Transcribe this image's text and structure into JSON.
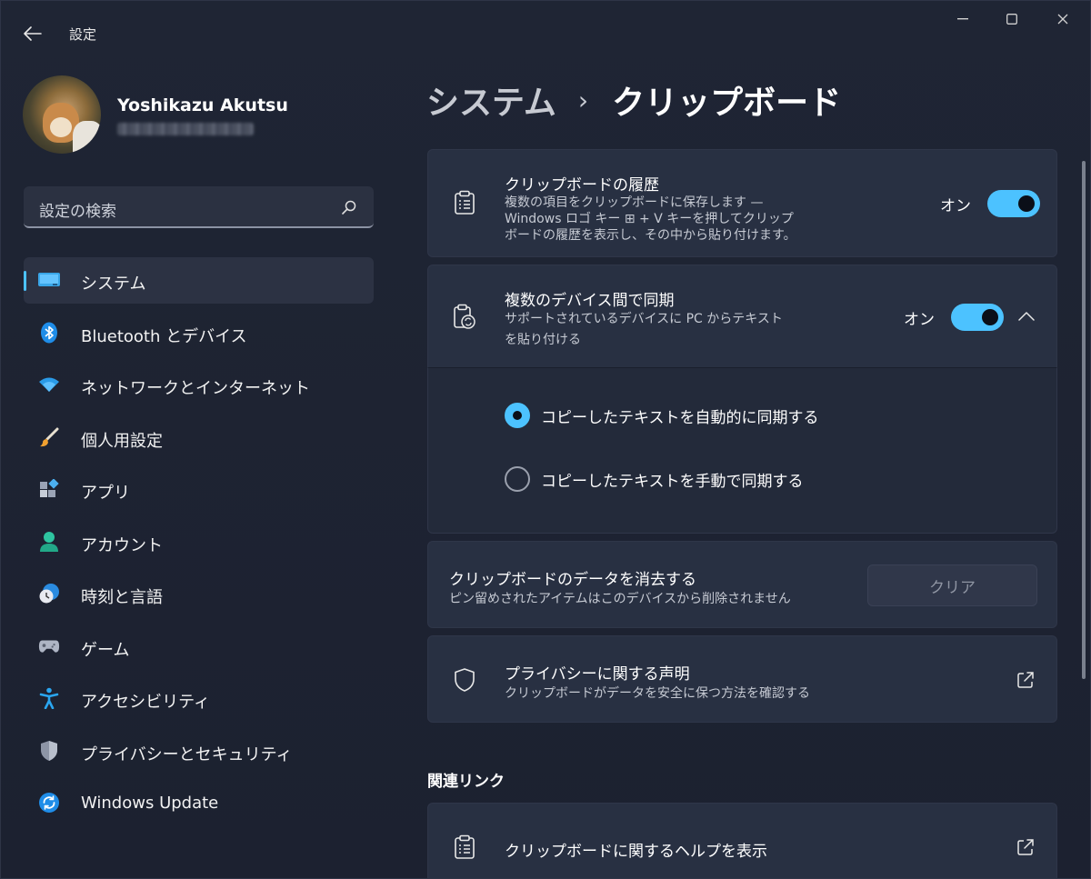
{
  "window": {
    "title": "設定"
  },
  "profile": {
    "name": "Yoshikazu Akutsu"
  },
  "search": {
    "placeholder": "設定の検索"
  },
  "sidebar": {
    "items": [
      {
        "label": "システム",
        "icon": "system-icon",
        "active": true
      },
      {
        "label": "Bluetooth とデバイス",
        "icon": "bluetooth-icon"
      },
      {
        "label": "ネットワークとインターネット",
        "icon": "wifi-icon"
      },
      {
        "label": "個人用設定",
        "icon": "brush-icon"
      },
      {
        "label": "アプリ",
        "icon": "apps-icon"
      },
      {
        "label": "アカウント",
        "icon": "account-icon"
      },
      {
        "label": "時刻と言語",
        "icon": "time-language-icon"
      },
      {
        "label": "ゲーム",
        "icon": "gamepad-icon"
      },
      {
        "label": "アクセシビリティ",
        "icon": "accessibility-icon"
      },
      {
        "label": "プライバシーとセキュリティ",
        "icon": "shield-icon"
      },
      {
        "label": "Windows Update",
        "icon": "update-icon"
      }
    ]
  },
  "breadcrumb": {
    "parent": "システム",
    "separator": "›",
    "current": "クリップボード"
  },
  "history": {
    "title": "クリップボードの履歴",
    "desc_line1": "複数の項目をクリップボードに保存します —",
    "desc_line2": "Windows ロゴ キー ⊞ + V キーを押してクリップ",
    "desc_line3": "ボードの履歴を表示し、その中から貼り付けます。",
    "toggle_label": "オン",
    "toggle_on": true
  },
  "sync": {
    "title": "複数のデバイス間で同期",
    "desc_line1": "サポートされているデバイスに PC からテキスト",
    "desc_line2": "を貼り付ける",
    "toggle_label": "オン",
    "toggle_on": true,
    "options": [
      {
        "label": "コピーしたテキストを自動的に同期する",
        "selected": true
      },
      {
        "label": "コピーしたテキストを手動で同期する",
        "selected": false
      }
    ]
  },
  "clear": {
    "title": "クリップボードのデータを消去する",
    "desc": "ピン留めされたアイテムはこのデバイスから削除されません",
    "button": "クリア"
  },
  "privacy": {
    "title": "プライバシーに関する声明",
    "desc": "クリップボードがデータを安全に保つ方法を確認する"
  },
  "related": {
    "heading": "関連リンク",
    "help_link": "クリップボードに関するヘルプを表示"
  },
  "colors": {
    "accent": "#4cc2ff",
    "background": "#1c2231",
    "card": "#283042"
  }
}
